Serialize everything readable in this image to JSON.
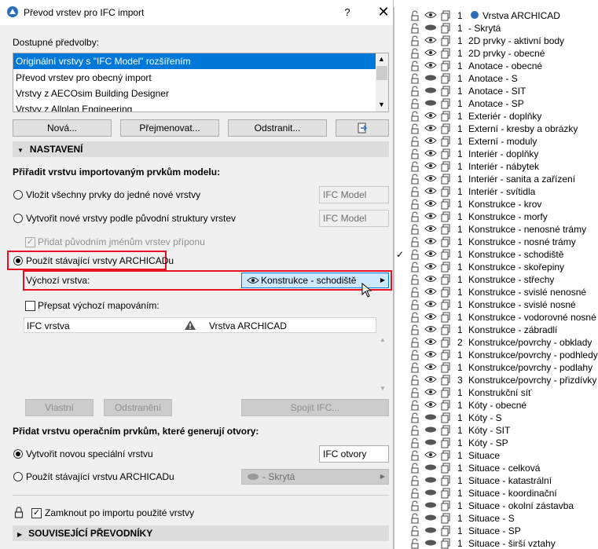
{
  "dialog": {
    "title": "Převod vrstev pro IFC import",
    "help": "?",
    "close": "✕",
    "presets_label": "Dostupné předvolby:",
    "presets": [
      {
        "label": "Originální vrstvy s \"IFC Model\" rozšířením",
        "selected": true
      },
      {
        "label": "Převod vrstev pro obecný import",
        "selected": false
      },
      {
        "label": "Vrstvy z AECOsim Building Designer",
        "selected": false
      },
      {
        "label": "Vrstvy z Allplan Engineering",
        "selected": false
      }
    ],
    "buttons": {
      "new": "Nová...",
      "rename": "Přejmenovat...",
      "delete": "Odstranit..."
    },
    "settings_header": "NASTAVENÍ",
    "assign_label": "Přiřadit vrstvu importovaným prvkům modelu:",
    "opt_single": "Vložit všechny prvky do jedné nové vrstvy",
    "opt_single_value": "IFC Model",
    "opt_structure": "Vytvořit nové vrstvy podle původní struktury vrstev",
    "opt_structure_value": "IFC Model",
    "add_suffix": "Přidat původním jménům vrstev příponu",
    "opt_existing": "Použít stávající vrstvy ARCHICADu",
    "default_layer_label": "Výchozí vrstva:",
    "default_layer_value": "Konstrukce - schodiště",
    "override_label": "Přepsat výchozí mapováním:",
    "table_col_ifc": "IFC vrstva",
    "table_col_archicad": "Vrstva ARCHICAD",
    "btn_own": "Vlastní",
    "btn_remove": "Odstranění",
    "btn_join": "Spojit IFC...",
    "openings_label": "Přidat vrstvu operačním prvkům, které generují otvory:",
    "opt_new_special": "Vytvořit novou speciální vrstvu",
    "opt_new_special_value": "IFC otvory",
    "opt_use_existing": "Použít stávající vrstvu ARCHICADu",
    "opt_use_existing_value": "- Skrytá",
    "lock_label": "Zamknout po importu použité vrstvy",
    "related_header": "SOUVISEJÍCÍ PŘEVODNÍKY",
    "colors": {
      "accent": "#0078d7",
      "highlight": "#e81123"
    }
  },
  "layer_menu": {
    "header": "Vrstva ARCHICAD",
    "items": [
      {
        "num": "1",
        "name": "- Skrytá",
        "hidden": true
      },
      {
        "num": "1",
        "name": "2D prvky - aktivní body",
        "hidden": false
      },
      {
        "num": "1",
        "name": "2D prvky - obecné",
        "hidden": false
      },
      {
        "num": "1",
        "name": "Anotace - obecné",
        "hidden": false
      },
      {
        "num": "1",
        "name": "Anotace - S",
        "hidden": true
      },
      {
        "num": "1",
        "name": "Anotace - SIT",
        "hidden": true
      },
      {
        "num": "1",
        "name": "Anotace - SP",
        "hidden": true
      },
      {
        "num": "1",
        "name": "Exteriér - doplňky",
        "hidden": false
      },
      {
        "num": "1",
        "name": "Externí - kresby a obrázky",
        "hidden": false
      },
      {
        "num": "1",
        "name": "Externí - moduly",
        "hidden": false
      },
      {
        "num": "1",
        "name": "Interiér - doplňky",
        "hidden": false
      },
      {
        "num": "1",
        "name": "Interiér - nábytek",
        "hidden": false
      },
      {
        "num": "1",
        "name": "Interiér - sanita a zařízení",
        "hidden": false
      },
      {
        "num": "1",
        "name": "Interiér - svítidla",
        "hidden": false
      },
      {
        "num": "1",
        "name": "Konstrukce - krov",
        "hidden": false
      },
      {
        "num": "1",
        "name": "Konstrukce - morfy",
        "hidden": false
      },
      {
        "num": "1",
        "name": "Konstrukce - nenosné trámy",
        "hidden": false
      },
      {
        "num": "1",
        "name": "Konstrukce - nosné trámy",
        "hidden": false
      },
      {
        "num": "1",
        "name": "Konstrukce - schodiště",
        "hidden": false,
        "checked": true
      },
      {
        "num": "1",
        "name": "Konstrukce - skořepiny",
        "hidden": false
      },
      {
        "num": "1",
        "name": "Konstrukce - střechy",
        "hidden": false
      },
      {
        "num": "1",
        "name": "Konstrukce - svislé nenosné",
        "hidden": false
      },
      {
        "num": "1",
        "name": "Konstrukce - svislé nosné",
        "hidden": false
      },
      {
        "num": "1",
        "name": "Konstrukce - vodorovné nosné",
        "hidden": false
      },
      {
        "num": "1",
        "name": "Konstrukce - zábradlí",
        "hidden": false
      },
      {
        "num": "2",
        "name": "Konstrukce/povrchy - obklady",
        "hidden": false
      },
      {
        "num": "1",
        "name": "Konstrukce/povrchy - podhledy",
        "hidden": false
      },
      {
        "num": "1",
        "name": "Konstrukce/povrchy - podlahy",
        "hidden": false
      },
      {
        "num": "3",
        "name": "Konstrukce/povrchy - přizdívky",
        "hidden": false
      },
      {
        "num": "1",
        "name": "Konstrukční síť",
        "hidden": false
      },
      {
        "num": "1",
        "name": "Kóty - obecné",
        "hidden": false
      },
      {
        "num": "1",
        "name": "Kóty - S",
        "hidden": true
      },
      {
        "num": "1",
        "name": "Kóty - SIT",
        "hidden": true
      },
      {
        "num": "1",
        "name": "Kóty - SP",
        "hidden": true
      },
      {
        "num": "1",
        "name": "Situace",
        "hidden": false
      },
      {
        "num": "1",
        "name": "Situace - celková",
        "hidden": true
      },
      {
        "num": "1",
        "name": "Situace - katastrální",
        "hidden": true
      },
      {
        "num": "1",
        "name": "Situace - koordinační",
        "hidden": true
      },
      {
        "num": "1",
        "name": "Situace - okolní zástavba",
        "hidden": true
      },
      {
        "num": "1",
        "name": "Situace - S",
        "hidden": true
      },
      {
        "num": "1",
        "name": "Situace - SP",
        "hidden": true
      },
      {
        "num": "1",
        "name": "Situace - širší vztahy",
        "hidden": true
      }
    ]
  }
}
